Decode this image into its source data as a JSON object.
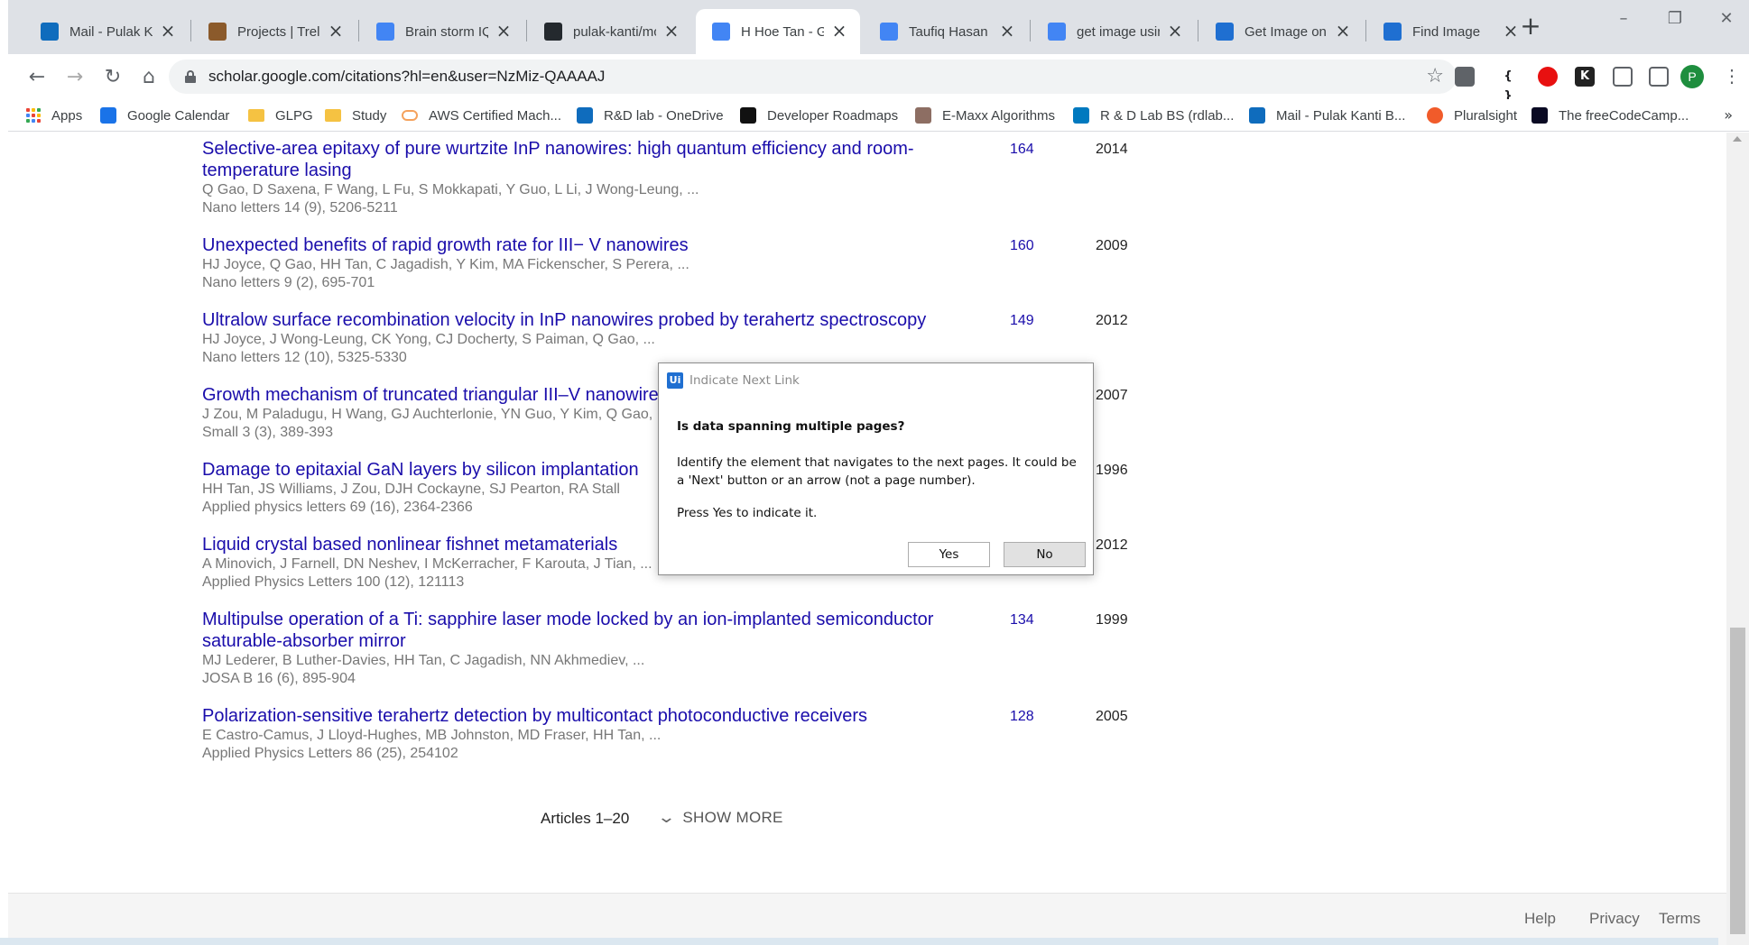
{
  "browser": {
    "tabs": [
      {
        "title": "Mail - Pulak Ka",
        "icon": "outlook-icon",
        "color": "#0f6cbd"
      },
      {
        "title": "Projects | Trello",
        "icon": "trello-icon",
        "color": "#8b5a2b"
      },
      {
        "title": "Brain storm IQ",
        "icon": "doc-icon",
        "color": "#4285f4"
      },
      {
        "title": "pulak-kanti/mc",
        "icon": "github-icon",
        "color": "#24292e"
      },
      {
        "title": "H Hoe Tan - Go",
        "icon": "scholar-icon",
        "color": "#4285f4"
      },
      {
        "title": "Taufiq Hasan -",
        "icon": "scholar-icon",
        "color": "#4285f4"
      },
      {
        "title": "get image usin",
        "icon": "google-icon",
        "color": "#4285f4"
      },
      {
        "title": "Get Image on V",
        "icon": "uipath-icon",
        "color": "#1f6fd1"
      },
      {
        "title": "Find Image",
        "icon": "uipath-icon",
        "color": "#1f6fd1"
      }
    ],
    "active_tab_index": 4,
    "new_tab_glyph": "+",
    "address": {
      "url": "scholar.google.com/citations?hl=en&user=NzMiz-QAAAAJ"
    },
    "profile_initial": "P",
    "extensions": [
      {
        "label": "",
        "icon": "extension-shield-icon",
        "bg": "#5f6368"
      },
      {
        "label": "{ }",
        "icon": "json-braces-icon",
        "bg": "#ffffff"
      },
      {
        "label": "",
        "icon": "opera-red-icon",
        "bg": "#e81010"
      },
      {
        "label": "K",
        "icon": "k-extension-icon",
        "bg": "#222222"
      },
      {
        "label": "",
        "icon": "shield-outline-icon",
        "bg": "#ffffff"
      },
      {
        "label": "",
        "icon": "puzzle-icon",
        "bg": "#ffffff"
      }
    ]
  },
  "bookmarks": [
    {
      "label": "Apps",
      "icon": "apps-grid-icon"
    },
    {
      "label": "Google Calendar",
      "icon": "calendar-icon",
      "color": "#1a73e8"
    },
    {
      "label": "GLPG",
      "icon": "folder-icon"
    },
    {
      "label": "Study",
      "icon": "folder-icon"
    },
    {
      "label": "AWS Certified Mach...",
      "icon": "cloud-icon",
      "color": "#f5a25d"
    },
    {
      "label": "R&D lab - OneDrive",
      "icon": "onedrive-icon",
      "color": "#0f6cbd"
    },
    {
      "label": "Developer Roadmaps",
      "icon": "roadmap-icon",
      "color": "#111111"
    },
    {
      "label": "E-Maxx Algorithms",
      "icon": "emaxx-icon",
      "color": "#8d6e63"
    },
    {
      "label": "R & D Lab BS (rdlab...",
      "icon": "trello-icon",
      "color": "#0079bf"
    },
    {
      "label": "Mail - Pulak Kanti B...",
      "icon": "outlook-icon",
      "color": "#0f6cbd"
    },
    {
      "label": "Pluralsight",
      "icon": "pluralsight-icon",
      "color": "#f15b2a"
    },
    {
      "label": "The freeCodeCamp...",
      "icon": "freecodecamp-icon",
      "color": "#0a0a23"
    }
  ],
  "bookmarks_more": "»",
  "articles": [
    {
      "title": "Selective-area epitaxy of pure wurtzite InP nanowires: high quantum efficiency and room-temperature lasing",
      "authors": "Q Gao, D Saxena, F Wang, L Fu, S Mokkapati, Y Guo, L Li, J Wong-Leung, ...",
      "venue": "Nano letters 14 (9), 5206-5211",
      "cited_by": "164",
      "year": "2014"
    },
    {
      "title": "Unexpected benefits of rapid growth rate for III− V nanowires",
      "authors": "HJ Joyce, Q Gao, HH Tan, C Jagadish, Y Kim, MA Fickenscher, S Perera, ...",
      "venue": "Nano letters 9 (2), 695-701",
      "cited_by": "160",
      "year": "2009"
    },
    {
      "title": "Ultralow surface recombination velocity in InP nanowires probed by terahertz spectroscopy",
      "authors": "HJ Joyce, J Wong-Leung, CK Yong, CJ Docherty, S Paiman, Q Gao, ...",
      "venue": "Nano letters 12 (10), 5325-5330",
      "cited_by": "149",
      "year": "2012"
    },
    {
      "title": "Growth mechanism of truncated triangular III–V nanowires",
      "authors": "J Zou, M Paladugu, H Wang, GJ Auchterlonie, YN Guo, Y Kim, Q Gao, ...",
      "venue": "Small 3 (3), 389-393",
      "cited_by": "",
      "year": "2007"
    },
    {
      "title": "Damage to epitaxial GaN layers by silicon implantation",
      "authors": "HH Tan, JS Williams, J Zou, DJH Cockayne, SJ Pearton, RA Stall",
      "venue": "Applied physics letters 69 (16), 2364-2366",
      "cited_by": "",
      "year": "1996"
    },
    {
      "title": "Liquid crystal based nonlinear fishnet metamaterials",
      "authors": "A Minovich, J Farnell, DN Neshev, I McKerracher, F Karouta, J Tian, ...",
      "venue": "Applied Physics Letters 100 (12), 121113",
      "cited_by": "",
      "year": "2012"
    },
    {
      "title": "Multipulse operation of a Ti: sapphire laser mode locked by an ion-implanted semiconductor saturable-absorber mirror",
      "authors": "MJ Lederer, B Luther-Davies, HH Tan, C Jagadish, NN Akhmediev, ...",
      "venue": "JOSA B 16 (6), 895-904",
      "cited_by": "134",
      "year": "1999"
    },
    {
      "title": "Polarization-sensitive terahertz detection by multicontact photoconductive receivers",
      "authors": "E Castro-Camus, J Lloyd-Hughes, MB Johnston, MD Fraser, HH Tan, ...",
      "venue": "Applied Physics Letters 86 (25), 254102",
      "cited_by": "128",
      "year": "2005"
    }
  ],
  "pagination": {
    "range_label": "Articles 1–20",
    "show_more_label": "SHOW MORE"
  },
  "footer": {
    "help": "Help",
    "privacy": "Privacy",
    "terms": "Terms"
  },
  "dialog": {
    "logo": "Ui",
    "title": "Indicate Next Link",
    "question": "Is data spanning multiple pages?",
    "message": "Identify the element that navigates to the next pages. It could be a 'Next' button or an arrow (not a page number).",
    "message2": "Press Yes to indicate it.",
    "yes_label": "Yes",
    "no_label": "No"
  }
}
